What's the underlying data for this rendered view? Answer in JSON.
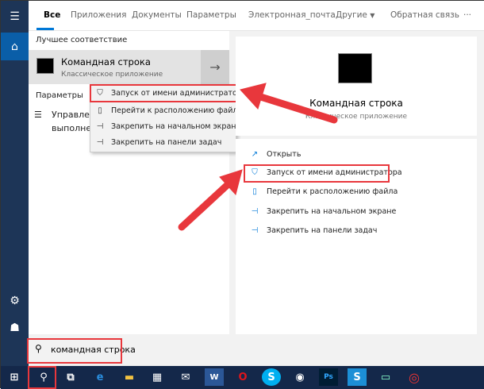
{
  "tabs": [
    {
      "label": "Все"
    },
    {
      "label": "Приложения"
    },
    {
      "label": "Документы"
    },
    {
      "label": "Параметры"
    },
    {
      "label": "Электронная_почта"
    },
    {
      "label": "Другие"
    }
  ],
  "feedback": "Обратная связь",
  "more": "···",
  "best_match_label": "Лучшее соответствие",
  "best_match": {
    "title": "Командная строка",
    "subtitle": "Классическое приложение"
  },
  "settings_label": "Параметры",
  "settings_item": {
    "line1": "Управлен",
    "line2": "выполнен"
  },
  "context_menu": [
    {
      "label": "Запуск от имени администратора"
    },
    {
      "label": "Перейти к расположению файла"
    },
    {
      "label": "Закрепить на начальном экране"
    },
    {
      "label": "Закрепить на панели задач"
    }
  ],
  "preview": {
    "title": "Командная строка",
    "subtitle": "Классическое приложение"
  },
  "actions": [
    {
      "label": "Открыть"
    },
    {
      "label": "Запуск от имени администратора"
    },
    {
      "label": "Перейти к расположению файла"
    },
    {
      "label": "Закрепить на начальном экране"
    },
    {
      "label": "Закрепить на панели задач"
    }
  ],
  "search": {
    "value": "командная строка"
  },
  "colors": {
    "accent": "#0078d7",
    "highlight": "#e8373c",
    "sidebar": "#1d3557",
    "taskbar": "#14284a"
  }
}
